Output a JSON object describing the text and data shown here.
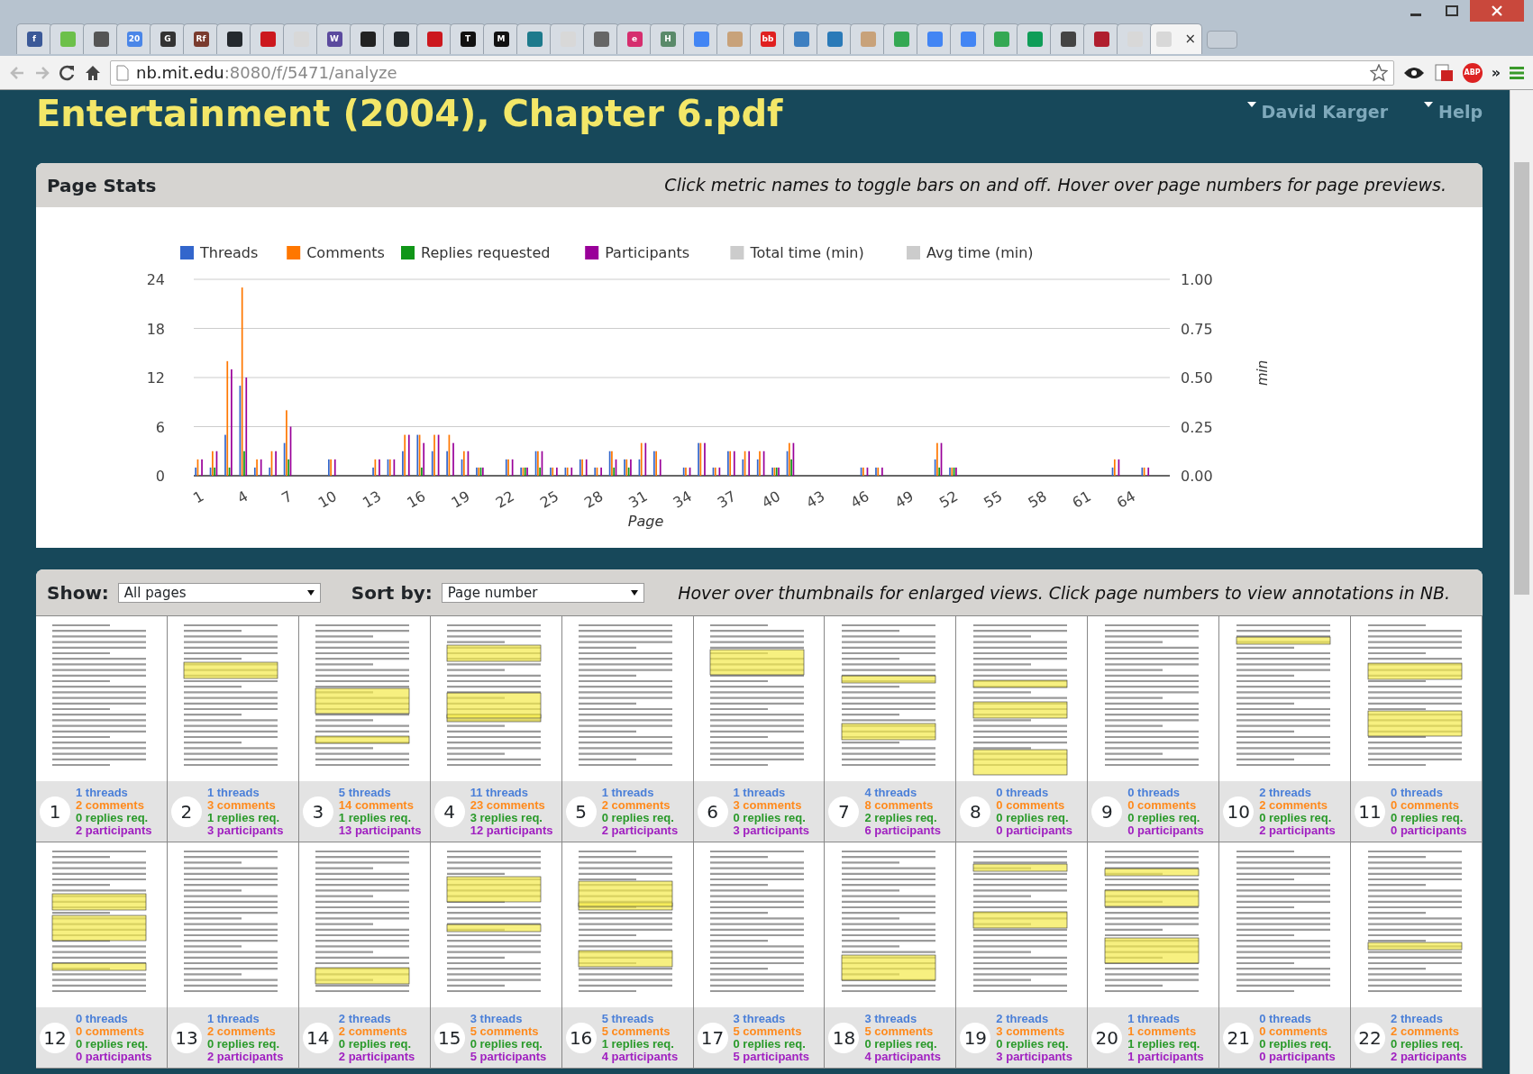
{
  "browser": {
    "tabs": [
      {
        "color": "#3b5998",
        "glyph": "f",
        "selected": false
      },
      {
        "color": "#6cc04a",
        "selected": false
      },
      {
        "color": "#555555",
        "selected": false
      },
      {
        "color": "#4a86e8",
        "glyph": "20",
        "selected": false
      },
      {
        "color": "#333333",
        "glyph": "G",
        "selected": false
      },
      {
        "color": "#7a3b2e",
        "glyph": "Rf",
        "selected": false
      },
      {
        "color": "#24292e",
        "selected": false
      },
      {
        "color": "#cc181e",
        "selected": false
      },
      {
        "color": "#d8d8d8",
        "selected": false
      },
      {
        "color": "#5b4a9e",
        "glyph": "W",
        "selected": false
      },
      {
        "color": "#222222",
        "selected": false
      },
      {
        "color": "#24292e",
        "selected": false
      },
      {
        "color": "#cc181e",
        "selected": false
      },
      {
        "color": "#111111",
        "glyph": "T",
        "selected": false
      },
      {
        "color": "#111111",
        "glyph": "M",
        "selected": false
      },
      {
        "color": "#1d7a8c",
        "selected": false
      },
      {
        "color": "#d8d8d8",
        "selected": false
      },
      {
        "color": "#666666",
        "selected": false
      },
      {
        "color": "#d62e6e",
        "glyph": "e",
        "selected": false
      },
      {
        "color": "#5a8a6a",
        "glyph": "H",
        "selected": false
      },
      {
        "color": "#4285f4",
        "selected": false
      },
      {
        "color": "#c8a27a",
        "selected": false
      },
      {
        "color": "#e02020",
        "glyph": "bb",
        "selected": false
      },
      {
        "color": "#3d7fc1",
        "selected": false
      },
      {
        "color": "#2a7ab8",
        "selected": false
      },
      {
        "color": "#c8a27a",
        "selected": false
      },
      {
        "color": "#34a853",
        "selected": false
      },
      {
        "color": "#4285f4",
        "selected": false
      },
      {
        "color": "#4285f4",
        "selected": false
      },
      {
        "color": "#34a853",
        "selected": false
      },
      {
        "color": "#0f9d58",
        "selected": false
      },
      {
        "color": "#444444",
        "selected": false
      },
      {
        "color": "#b01e2e",
        "selected": false
      },
      {
        "color": "#d8d8d8",
        "selected": false
      },
      {
        "color": "#d8d8d8",
        "selected": true,
        "close": "×"
      }
    ],
    "url_host": "nb.mit.edu",
    "url_path": ":8080/f/5471/analyze",
    "extension_badge": "ABP",
    "overflow": "»"
  },
  "title": "Entertainment (2004), Chapter 6.pdf",
  "user_menu": [
    {
      "label": "David Karger"
    },
    {
      "label": "Help"
    }
  ],
  "stats_panel": {
    "title": "Page Stats",
    "hint": "Click metric names to toggle bars on and off. Hover over page numbers for page previews.",
    "chart_data": {
      "type": "bar",
      "xlabel": "Page",
      "ylim": [
        0,
        24
      ],
      "yticks": [
        0,
        6,
        12,
        18,
        24
      ],
      "y2lim": [
        0,
        1
      ],
      "y2ticks": [
        {
          "value": 0,
          "label": "0.00"
        },
        {
          "value": 0.25,
          "label": "0.25"
        },
        {
          "value": 0.5,
          "label": "0.50"
        },
        {
          "value": 0.75,
          "label": "0.75"
        },
        {
          "value": 1,
          "label": "1.00"
        }
      ],
      "y2label": "min",
      "grid": true,
      "legend": "top",
      "x": [
        1,
        2,
        3,
        4,
        5,
        6,
        7,
        8,
        9,
        10,
        11,
        12,
        13,
        14,
        15,
        16,
        17,
        18,
        19,
        20,
        21,
        22,
        23,
        24,
        25,
        26,
        27,
        28,
        29,
        30,
        31,
        32,
        33,
        34,
        35,
        36,
        37,
        38,
        39,
        40,
        41,
        42,
        43,
        44,
        45,
        46,
        47,
        48,
        49,
        50,
        51,
        52,
        53,
        54,
        55,
        56,
        57,
        58,
        59,
        60,
        61,
        62,
        63,
        64,
        65,
        66
      ],
      "xlim": [
        0.5,
        66.5
      ],
      "xticks": [
        1,
        4,
        7,
        10,
        13,
        16,
        19,
        22,
        25,
        28,
        31,
        34,
        37,
        40,
        43,
        46,
        49,
        52,
        55,
        58,
        61,
        64
      ],
      "series": [
        {
          "name": "Threads",
          "color": "#3366cc",
          "values": [
            1,
            1,
            5,
            11,
            1,
            1,
            4,
            0,
            0,
            2,
            0,
            0,
            1,
            2,
            3,
            5,
            3,
            3,
            2,
            1,
            0,
            2,
            1,
            3,
            1,
            1,
            2,
            1,
            3,
            2,
            2,
            3,
            0,
            1,
            4,
            1,
            3,
            2,
            2,
            1,
            3,
            0,
            0,
            0,
            0,
            1,
            1,
            0,
            0,
            0,
            2,
            1,
            0,
            0,
            0,
            0,
            0,
            0,
            0,
            0,
            0,
            0,
            1,
            0,
            1,
            0
          ]
        },
        {
          "name": "Comments",
          "color": "#ff7700",
          "values": [
            2,
            3,
            14,
            23,
            2,
            3,
            8,
            0,
            0,
            2,
            0,
            0,
            2,
            2,
            5,
            5,
            5,
            5,
            3,
            1,
            0,
            2,
            1,
            3,
            1,
            1,
            2,
            1,
            3,
            2,
            4,
            3,
            0,
            1,
            4,
            1,
            3,
            3,
            3,
            1,
            4,
            0,
            0,
            0,
            0,
            1,
            1,
            0,
            0,
            0,
            4,
            1,
            0,
            0,
            0,
            0,
            0,
            0,
            0,
            0,
            0,
            0,
            2,
            0,
            1,
            0
          ]
        },
        {
          "name": "Replies requested",
          "color": "#109618",
          "values": [
            0,
            1,
            1,
            3,
            0,
            0,
            2,
            0,
            0,
            0,
            0,
            0,
            0,
            0,
            0,
            1,
            0,
            0,
            0,
            1,
            0,
            0,
            1,
            1,
            0,
            0,
            0,
            0,
            1,
            1,
            0,
            0,
            0,
            0,
            0,
            0,
            0,
            0,
            0,
            1,
            2,
            0,
            0,
            0,
            0,
            0,
            0,
            0,
            0,
            0,
            1,
            1,
            0,
            0,
            0,
            0,
            0,
            0,
            0,
            0,
            0,
            0,
            0,
            0,
            0,
            0
          ]
        },
        {
          "name": "Participants",
          "color": "#990099",
          "values": [
            2,
            3,
            13,
            12,
            2,
            3,
            6,
            0,
            0,
            2,
            0,
            0,
            2,
            2,
            5,
            4,
            5,
            4,
            3,
            1,
            0,
            2,
            1,
            3,
            1,
            1,
            2,
            1,
            2,
            2,
            4,
            2,
            0,
            1,
            4,
            1,
            3,
            3,
            3,
            1,
            4,
            0,
            0,
            0,
            0,
            1,
            1,
            0,
            0,
            0,
            4,
            1,
            0,
            0,
            0,
            0,
            0,
            0,
            0,
            0,
            0,
            0,
            2,
            0,
            1,
            0
          ]
        },
        {
          "name": "Total time (min)",
          "color": "#cccccc",
          "values": [
            0,
            0,
            0,
            0,
            0,
            0,
            0,
            0,
            0,
            0,
            0,
            0,
            0,
            0,
            0,
            0,
            0,
            0,
            0,
            0,
            0,
            0,
            0,
            0,
            0,
            0,
            0,
            0,
            0,
            0,
            0,
            0,
            0,
            0,
            0,
            0,
            0,
            0,
            0,
            0,
            0,
            0,
            0,
            0,
            0,
            0,
            0,
            0,
            0,
            0,
            0,
            0,
            0,
            0,
            0,
            0,
            0,
            0,
            0,
            0,
            0,
            0,
            0,
            0,
            0,
            0
          ]
        },
        {
          "name": "Avg time (min)",
          "color": "#cccccc",
          "values": [
            0,
            0,
            0,
            0,
            0,
            0,
            0,
            0,
            0,
            0,
            0,
            0,
            0,
            0,
            0,
            0,
            0,
            0,
            0,
            0,
            0,
            0,
            0,
            0,
            0,
            0,
            0,
            0,
            0,
            0,
            0,
            0,
            0,
            0,
            0,
            0,
            0,
            0,
            0,
            0,
            0,
            0,
            0,
            0,
            0,
            0,
            0,
            0,
            0,
            0,
            0,
            0,
            0,
            0,
            0,
            0,
            0,
            0,
            0,
            0,
            0,
            0,
            0,
            0,
            0,
            0
          ]
        }
      ]
    }
  },
  "pages_panel": {
    "show_label": "Show:",
    "show_value": "All pages",
    "sort_label": "Sort by:",
    "sort_value": "Page number",
    "hint": "Hover over thumbnails for enlarged views. Click page numbers to view annotations in NB.",
    "pages": [
      {
        "number": "1",
        "threads": "1 threads",
        "comments": "2 comments",
        "replies": "0 replies req.",
        "participants": "2 participants"
      },
      {
        "number": "2",
        "threads": "1 threads",
        "comments": "3 comments",
        "replies": "1 replies req.",
        "participants": "3 participants"
      },
      {
        "number": "3",
        "threads": "5 threads",
        "comments": "14 comments",
        "replies": "1 replies req.",
        "participants": "13 participants"
      },
      {
        "number": "4",
        "threads": "11 threads",
        "comments": "23 comments",
        "replies": "3 replies req.",
        "participants": "12 participants"
      },
      {
        "number": "5",
        "threads": "1 threads",
        "comments": "2 comments",
        "replies": "0 replies req.",
        "participants": "2 participants"
      },
      {
        "number": "6",
        "threads": "1 threads",
        "comments": "3 comments",
        "replies": "0 replies req.",
        "participants": "3 participants"
      },
      {
        "number": "7",
        "threads": "4 threads",
        "comments": "8 comments",
        "replies": "2 replies req.",
        "participants": "6 participants"
      },
      {
        "number": "8",
        "threads": "0 threads",
        "comments": "0 comments",
        "replies": "0 replies req.",
        "participants": "0 participants"
      },
      {
        "number": "9",
        "threads": "0 threads",
        "comments": "0 comments",
        "replies": "0 replies req.",
        "participants": "0 participants"
      },
      {
        "number": "10",
        "threads": "2 threads",
        "comments": "2 comments",
        "replies": "0 replies req.",
        "participants": "2 participants"
      },
      {
        "number": "11",
        "threads": "0 threads",
        "comments": "0 comments",
        "replies": "0 replies req.",
        "participants": "0 participants"
      },
      {
        "number": "12",
        "threads": "0 threads",
        "comments": "0 comments",
        "replies": "0 replies req.",
        "participants": "0 participants"
      },
      {
        "number": "13",
        "threads": "1 threads",
        "comments": "2 comments",
        "replies": "0 replies req.",
        "participants": "2 participants"
      },
      {
        "number": "14",
        "threads": "2 threads",
        "comments": "2 comments",
        "replies": "0 replies req.",
        "participants": "2 participants"
      },
      {
        "number": "15",
        "threads": "3 threads",
        "comments": "5 comments",
        "replies": "0 replies req.",
        "participants": "5 participants"
      },
      {
        "number": "16",
        "threads": "5 threads",
        "comments": "5 comments",
        "replies": "1 replies req.",
        "participants": "4 participants"
      },
      {
        "number": "17",
        "threads": "3 threads",
        "comments": "5 comments",
        "replies": "0 replies req.",
        "participants": "5 participants"
      },
      {
        "number": "18",
        "threads": "3 threads",
        "comments": "5 comments",
        "replies": "0 replies req.",
        "participants": "4 participants"
      },
      {
        "number": "19",
        "threads": "2 threads",
        "comments": "3 comments",
        "replies": "0 replies req.",
        "participants": "3 participants"
      },
      {
        "number": "20",
        "threads": "1 threads",
        "comments": "1 comments",
        "replies": "1 replies req.",
        "participants": "1 participants"
      },
      {
        "number": "21",
        "threads": "0 threads",
        "comments": "0 comments",
        "replies": "0 replies req.",
        "participants": "0 participants"
      },
      {
        "number": "22",
        "threads": "2 threads",
        "comments": "2 comments",
        "replies": "0 replies req.",
        "participants": "2 participants"
      }
    ]
  }
}
